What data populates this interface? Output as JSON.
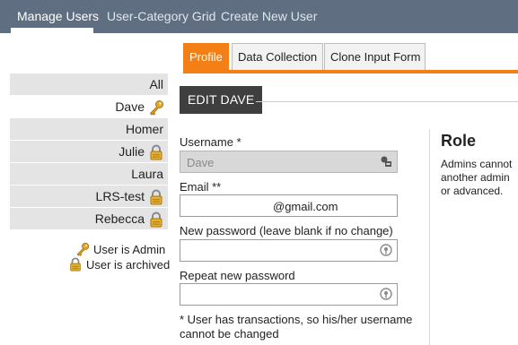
{
  "nav": {
    "items": [
      "Manage Users",
      "User-Category Grid",
      "Create New User"
    ]
  },
  "users": {
    "all_label": "All",
    "items": [
      {
        "name": "Dave",
        "icon": "key-icon"
      },
      {
        "name": "Homer",
        "icon": ""
      },
      {
        "name": "Julie",
        "icon": "lock-icon"
      },
      {
        "name": "Laura",
        "icon": ""
      },
      {
        "name": "LRS-test",
        "icon": "lock-icon"
      },
      {
        "name": "Rebecca",
        "icon": "lock-icon"
      }
    ],
    "selected": "Dave"
  },
  "legend": {
    "admin": "User is Admin",
    "archived": "User is archived"
  },
  "tabs": [
    "Profile",
    "Data Collection",
    "Clone Input Form"
  ],
  "edit": {
    "title": "EDIT DAVE"
  },
  "form": {
    "username_label": "Username *",
    "username_value": "Dave",
    "email_label": "Email **",
    "email_value": "@gmail.com",
    "new_password_label": "New password (leave blank if no change)",
    "repeat_password_label": "Repeat new password",
    "note": "* User has transactions, so his/her username cannot be changed"
  },
  "role": {
    "title": "Role",
    "text_lines": [
      "Admins cannot",
      "another admin",
      "or advanced."
    ]
  },
  "colors": {
    "nav_bg": "#5f6f81",
    "accent": "#f57f17",
    "header_bg": "#3f3f3f",
    "list_bg": "#e4e4e4",
    "key": "#e1a92b",
    "lock": "#e5b22f"
  }
}
